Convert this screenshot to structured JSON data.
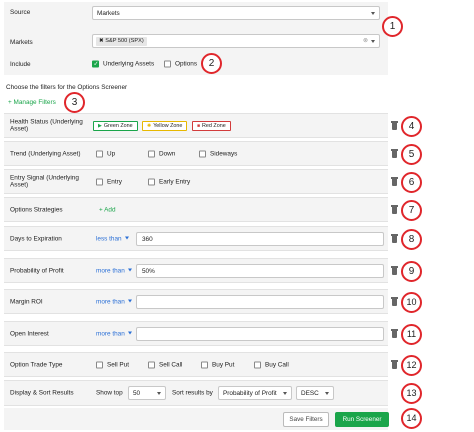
{
  "top": {
    "source_label": "Source",
    "source_value": "Markets",
    "markets_label": "Markets",
    "markets_tag": "S&P 500 (SPX)",
    "include_label": "Include",
    "underlying_label": "Underlying Assets",
    "options_label": "Options"
  },
  "filters_heading": "Choose the filters for the Options Screener",
  "manage_filters": "Manage Filters",
  "health": {
    "label": "Health Status (Underlying Asset)",
    "green": "Green Zone",
    "yellow": "Yellow Zone",
    "red": "Red Zone"
  },
  "trend": {
    "label": "Trend (Underlying Asset)",
    "up": "Up",
    "down": "Down",
    "sideways": "Sideways"
  },
  "entry": {
    "label": "Entry Signal (Underlying Asset)",
    "entry": "Entry",
    "early": "Early Entry"
  },
  "strategies": {
    "label": "Options Strategies",
    "add": "+ Add"
  },
  "days": {
    "label": "Days to Expiration",
    "op": "less than",
    "value": "360"
  },
  "prob": {
    "label": "Probability of Profit",
    "op": "more than",
    "value": "50%"
  },
  "margin": {
    "label": "Margin ROI",
    "op": "more than",
    "value": ""
  },
  "oi": {
    "label": "Open Interest",
    "op": "more than",
    "value": ""
  },
  "trade": {
    "label": "Option Trade Type",
    "sell_put": "Sell Put",
    "sell_call": "Sell Call",
    "buy_put": "Buy Put",
    "buy_call": "Buy Call"
  },
  "display": {
    "label": "Display & Sort Results",
    "show_top": "Show top",
    "top_value": "50",
    "sort_by": "Sort results by",
    "sort_value": "Probability of Profit",
    "order_value": "DESC"
  },
  "save_filters": "Save Filters",
  "run_screener": "Run Screener",
  "badges": [
    "1",
    "2",
    "3",
    "4",
    "5",
    "6",
    "7",
    "8",
    "9",
    "10",
    "11",
    "12",
    "13",
    "14"
  ],
  "colors": {
    "green": "#1aa54a",
    "blue": "#2a6fd6",
    "badge_red": "#e0262b",
    "yellow": "#e7b800",
    "red": "#d23b3b"
  }
}
